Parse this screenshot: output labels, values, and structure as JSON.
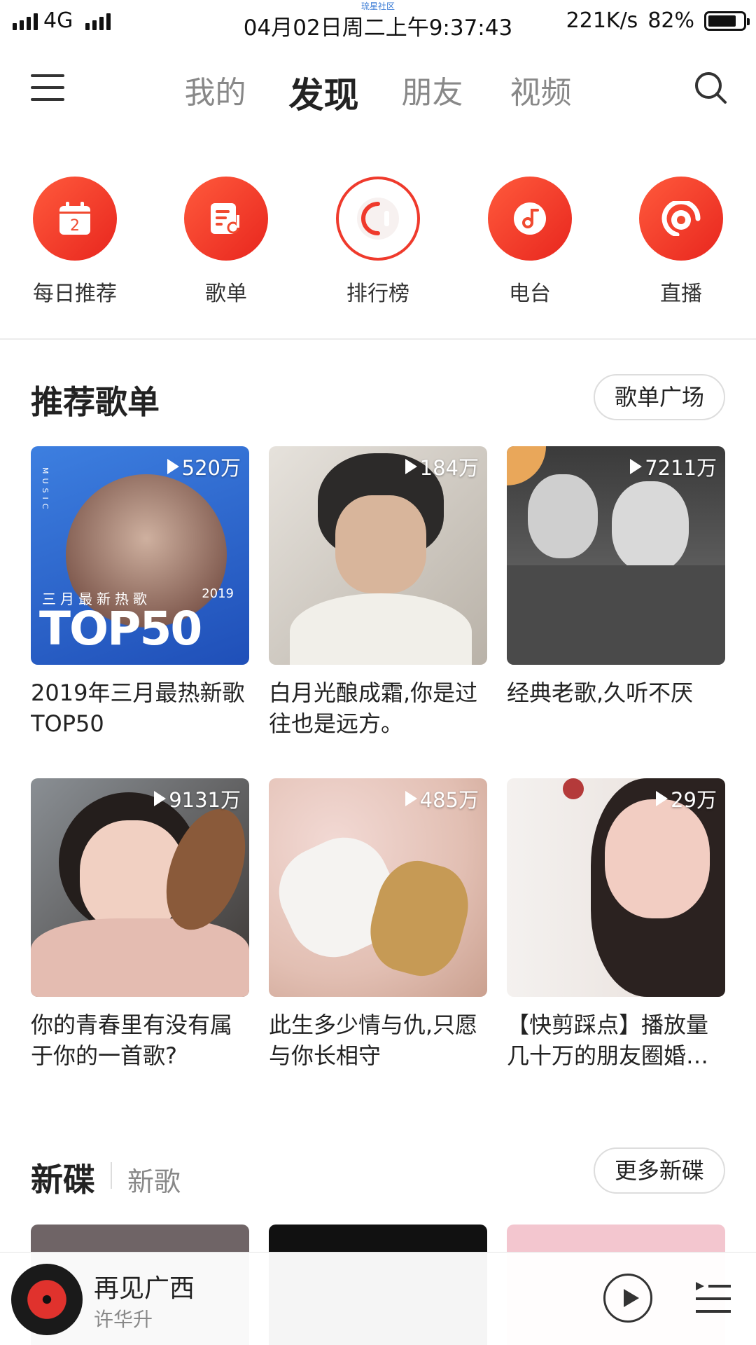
{
  "status_bar": {
    "network": "4G",
    "watermark": "琉星社区",
    "time": "04月02日周二上午9:37:43",
    "speed": "221K/s",
    "battery": "82%",
    "battery_level": 0.82
  },
  "header": {
    "tabs": [
      {
        "label": "我的",
        "active": false
      },
      {
        "label": "发现",
        "active": true
      },
      {
        "label": "朋友",
        "active": false
      },
      {
        "label": "视频",
        "active": false
      }
    ]
  },
  "quick_entries": [
    {
      "label": "每日推荐",
      "icon": "calendar-icon",
      "day": "2"
    },
    {
      "label": "歌单",
      "icon": "playlist-icon"
    },
    {
      "label": "排行榜",
      "icon": "chart-icon"
    },
    {
      "label": "电台",
      "icon": "radio-icon"
    },
    {
      "label": "直播",
      "icon": "live-icon"
    }
  ],
  "recommended": {
    "title": "推荐歌单",
    "more_button": "歌单广场",
    "playlists": [
      {
        "plays": "520万",
        "title": "2019年三月最热新歌TOP50",
        "cover_text": "三月最新热歌",
        "cover_year": "2019",
        "cover_big": "TOP50",
        "cover_colors": [
          "#2f6fd8",
          "#8aa8e8"
        ]
      },
      {
        "plays": "184万",
        "title": "白月光酿成霜,你是过往也是远方。",
        "cover_colors": [
          "#cfcac2",
          "#6d6760"
        ]
      },
      {
        "plays": "7211万",
        "title": "经典老歌,久听不厌",
        "cover_colors": [
          "#555",
          "#cfcfcf"
        ]
      },
      {
        "plays": "9131万",
        "title": "你的青春里有没有属于你的一首歌?",
        "cover_colors": [
          "#d9b8a8",
          "#6b4a3a"
        ]
      },
      {
        "plays": "485万",
        "title": "此生多少情与仇,只愿与你长相守",
        "cover_colors": [
          "#e9d2c8",
          "#c9a060"
        ]
      },
      {
        "plays": "29万",
        "title": "【快剪踩点】播放量几十万的朋友圈婚…",
        "cover_colors": [
          "#ede7e3",
          "#a88b82"
        ]
      }
    ]
  },
  "new_disc": {
    "title": "新碟",
    "subtab": "新歌",
    "more_button": "更多新碟",
    "thumb_colors": [
      "#6f6466",
      "#111",
      "#f3c6cf"
    ]
  },
  "mini_player": {
    "title": "再见广西",
    "artist": "许华升"
  }
}
